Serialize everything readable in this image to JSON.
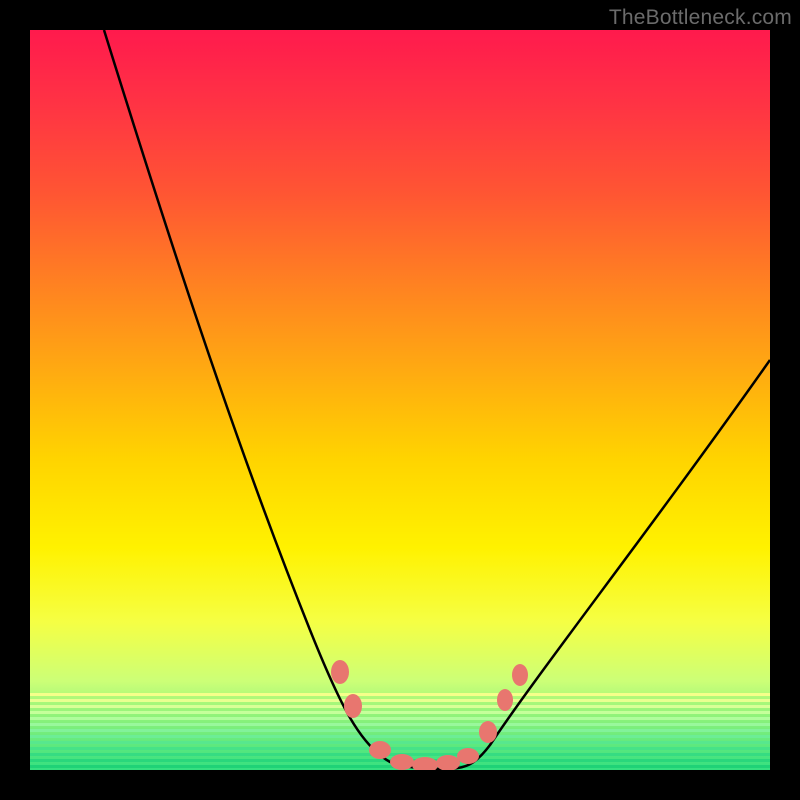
{
  "watermark": "TheBottleneck.com",
  "chart_data": {
    "type": "line",
    "title": "",
    "xlabel": "",
    "ylabel": "",
    "xlim": [
      0,
      100
    ],
    "ylim": [
      0,
      100
    ],
    "grid": false,
    "legend": false,
    "series": [
      {
        "name": "bottleneck-curve",
        "x": [
          10,
          15,
          20,
          25,
          30,
          35,
          40,
          43,
          46,
          49,
          52,
          55,
          58,
          63,
          70,
          80,
          90,
          100
        ],
        "y": [
          100,
          88,
          76,
          64,
          52,
          40,
          28,
          18,
          8,
          2,
          0,
          0,
          0,
          5,
          15,
          30,
          44,
          56
        ]
      }
    ],
    "markers": [
      {
        "name": "left-marker-1",
        "x": 42,
        "y": 15
      },
      {
        "name": "left-marker-2",
        "x": 44,
        "y": 10
      },
      {
        "name": "flat-marker-1",
        "x": 48,
        "y": 1
      },
      {
        "name": "flat-marker-2",
        "x": 51,
        "y": 0
      },
      {
        "name": "flat-marker-3",
        "x": 54,
        "y": 0
      },
      {
        "name": "flat-marker-4",
        "x": 57,
        "y": 0
      },
      {
        "name": "flat-marker-5",
        "x": 59,
        "y": 1
      },
      {
        "name": "right-marker-1",
        "x": 62,
        "y": 6
      },
      {
        "name": "right-marker-2",
        "x": 65,
        "y": 11
      },
      {
        "name": "right-marker-3",
        "x": 67,
        "y": 14
      }
    ],
    "marker_color": "#e8766f",
    "curve_color": "#000000"
  },
  "colors": {
    "frame": "#000000",
    "gradient_top": "#ff1a4d",
    "gradient_bottom": "#33e080",
    "watermark": "#6b6b6b"
  }
}
